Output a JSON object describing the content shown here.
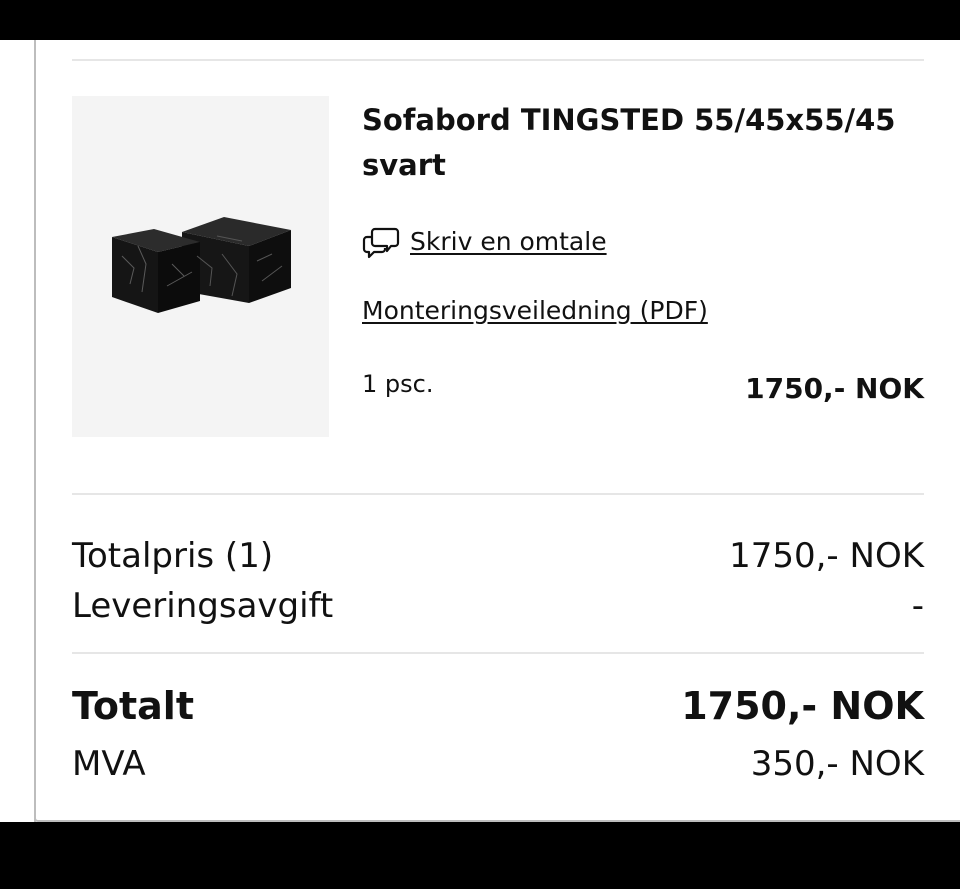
{
  "product": {
    "title": "Sofabord TINGSTED 55/45x55/45 svart",
    "image_icon": "marble-cube-tables-image",
    "review_icon": "speech-bubbles-icon",
    "review_link": "Skriv en omtale",
    "manual_link": "Monteringsveiledning (PDF)",
    "quantity": "1 psc.",
    "price": "1750,- NOK"
  },
  "summary": {
    "subtotal_label": "Totalpris (1)",
    "subtotal_value": "1750,- NOK",
    "delivery_label": "Leveringsavgift",
    "delivery_value": "-",
    "total_label": "Totalt",
    "total_value": "1750,- NOK",
    "vat_label": "MVA",
    "vat_value": "350,- NOK"
  },
  "colors": {
    "text": "#111111",
    "divider": "#e6e6e6",
    "image_background": "#f4f4f4"
  }
}
